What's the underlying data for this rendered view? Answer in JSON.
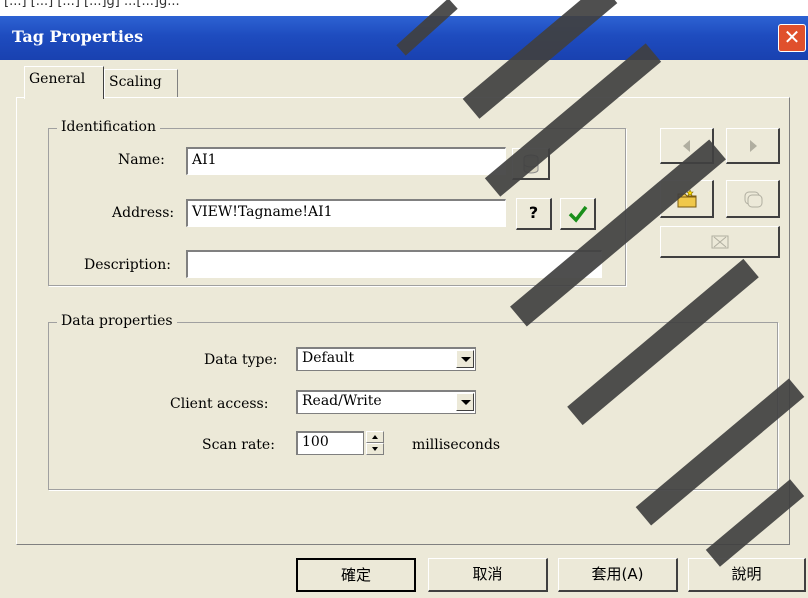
{
  "top_strip_text": "[...] [...] [...] [...]g] ...[...]g...",
  "window": {
    "title": "Tag Properties",
    "close_glyph": "✕"
  },
  "tabs": [
    {
      "label": "General"
    },
    {
      "label": "Scaling"
    }
  ],
  "identification": {
    "legend": "Identification",
    "name_label": "Name:",
    "name_value": "AI1",
    "address_label": "Address:",
    "address_value": "VIEW!Tagname!AI1",
    "description_label": "Description:",
    "description_value": "",
    "help_button": "?"
  },
  "data_properties": {
    "legend": "Data properties",
    "data_type_label": "Data type:",
    "data_type_value": "Default",
    "client_access_label": "Client access:",
    "client_access_value": "Read/Write",
    "scan_rate_label": "Scan rate:",
    "scan_rate_value": "100",
    "scan_rate_unit": "milliseconds"
  },
  "footer": {
    "ok": "確定",
    "cancel": "取消",
    "apply": "套用(A)",
    "help": "說明"
  },
  "icons": [
    "browse-icon",
    "help-icon",
    "check-icon",
    "prev-icon",
    "next-icon",
    "new-tag-icon",
    "copy-tag-icon",
    "delete-tag-icon",
    "close-icon"
  ],
  "colors": {
    "titlebar": "#1e4cbf",
    "close": "#e0502c",
    "check": "#1a8f1a",
    "face": "#ece9d8"
  }
}
